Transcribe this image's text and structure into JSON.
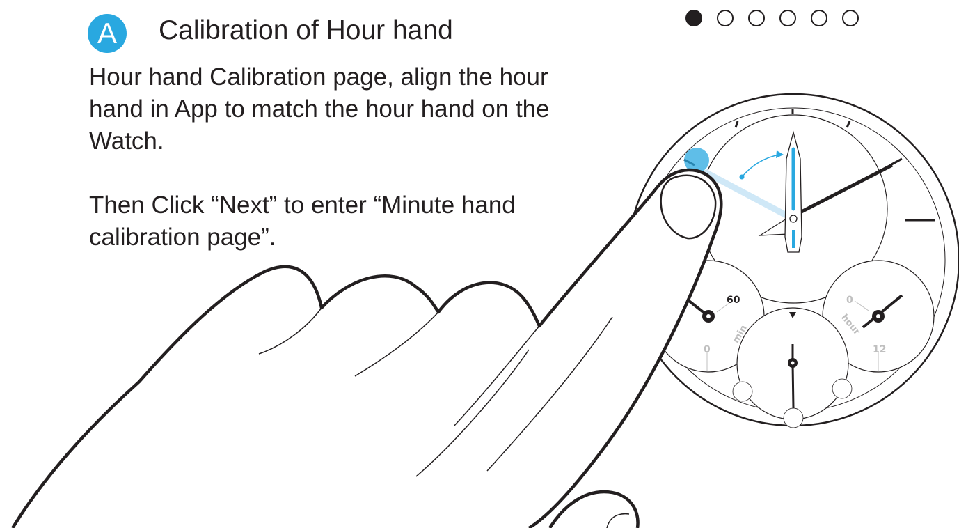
{
  "step": {
    "badge_letter": "A",
    "title": "Calibration of Hour hand"
  },
  "instructions": {
    "paragraph_1": "Hour hand Calibration page, align the hour hand in App to match the hour hand on the Watch.",
    "paragraph_2": "Then Click “Next” to enter “Minute hand calibration page”."
  },
  "pager": {
    "total": 6,
    "active_index": 0
  },
  "watch": {
    "left_subdial": {
      "top_value": "60",
      "bottom_value": "0",
      "label": "min"
    },
    "right_subdial": {
      "top_value": "0",
      "bottom_value": "12",
      "label": "hour"
    }
  },
  "colors": {
    "accent": "#29a8e0",
    "ink": "#231f20",
    "subdial_text": "#bfbfbf"
  },
  "icons": [
    "pointing-hand-icon",
    "watch-face-icon",
    "curved-arrow-icon"
  ]
}
